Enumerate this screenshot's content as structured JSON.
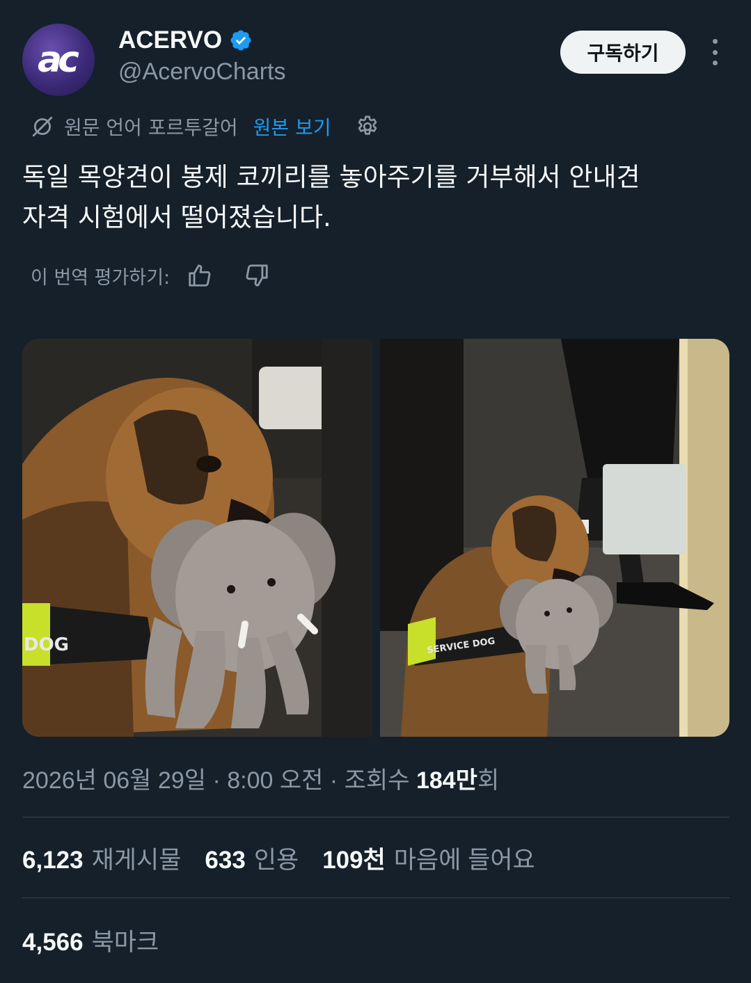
{
  "author": {
    "avatar_text": "ac",
    "display_name": "ACERVO",
    "handle": "@AcervoCharts",
    "verified": true,
    "verified_color": "#1d9bf0"
  },
  "header": {
    "subscribe_label": "구독하기",
    "more_icon": "more-vertical-icon"
  },
  "translation": {
    "icon": "translate-off-icon",
    "language_text": "원문 언어 포르투갈어",
    "show_original_label": "원본 보기",
    "settings_icon": "gear-icon"
  },
  "tweet": {
    "text_line1": "독일 목양견이 봉제 코끼리를 놓아주기를 거부해서 안내견",
    "text_line2": "자격 시험에서 떨어졌습니다."
  },
  "rating": {
    "label": "이 번역 평가하기:",
    "thumbs_up_icon": "thumbs-up-icon",
    "thumbs_down_icon": "thumbs-down-icon"
  },
  "photos": [
    {
      "name": "photo-dog-closeup",
      "harness_text": "DOG"
    },
    {
      "name": "photo-dog-platform",
      "harness_text": "SERVICE DOG"
    }
  ],
  "meta": {
    "date": "2026년 06월 29일",
    "sep1": " · ",
    "time": "8:00 오전",
    "sep2": " · ",
    "views_prefix": "조회수 ",
    "views_value": "184만",
    "views_suffix": "회"
  },
  "stats": {
    "reposts_count": "6,123",
    "reposts_label": "재게시물",
    "quotes_count": "633",
    "quotes_label": "인용",
    "likes_count": "109천",
    "likes_label": "마음에 들어요",
    "bookmarks_count": "4,566",
    "bookmarks_label": "북마크"
  },
  "colors": {
    "background": "#15202b",
    "accent": "#1d9bf0",
    "muted": "#8b98a5",
    "divider": "#38444d"
  }
}
